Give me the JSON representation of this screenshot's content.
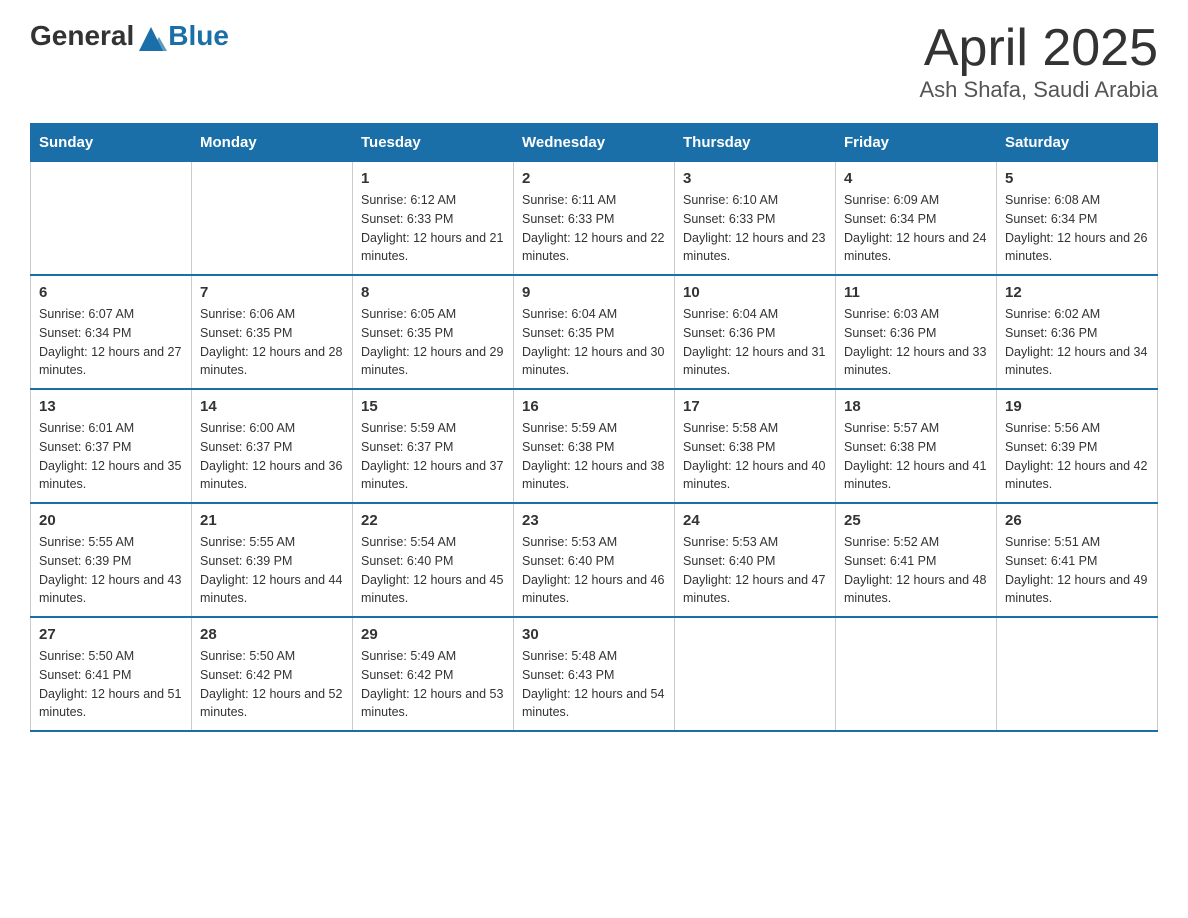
{
  "header": {
    "logo": {
      "general": "General",
      "blue": "Blue"
    },
    "title": "April 2025",
    "subtitle": "Ash Shafa, Saudi Arabia"
  },
  "calendar": {
    "days_of_week": [
      "Sunday",
      "Monday",
      "Tuesday",
      "Wednesday",
      "Thursday",
      "Friday",
      "Saturday"
    ],
    "weeks": [
      [
        {
          "day": "",
          "sunrise": "",
          "sunset": "",
          "daylight": ""
        },
        {
          "day": "",
          "sunrise": "",
          "sunset": "",
          "daylight": ""
        },
        {
          "day": "1",
          "sunrise": "Sunrise: 6:12 AM",
          "sunset": "Sunset: 6:33 PM",
          "daylight": "Daylight: 12 hours and 21 minutes."
        },
        {
          "day": "2",
          "sunrise": "Sunrise: 6:11 AM",
          "sunset": "Sunset: 6:33 PM",
          "daylight": "Daylight: 12 hours and 22 minutes."
        },
        {
          "day": "3",
          "sunrise": "Sunrise: 6:10 AM",
          "sunset": "Sunset: 6:33 PM",
          "daylight": "Daylight: 12 hours and 23 minutes."
        },
        {
          "day": "4",
          "sunrise": "Sunrise: 6:09 AM",
          "sunset": "Sunset: 6:34 PM",
          "daylight": "Daylight: 12 hours and 24 minutes."
        },
        {
          "day": "5",
          "sunrise": "Sunrise: 6:08 AM",
          "sunset": "Sunset: 6:34 PM",
          "daylight": "Daylight: 12 hours and 26 minutes."
        }
      ],
      [
        {
          "day": "6",
          "sunrise": "Sunrise: 6:07 AM",
          "sunset": "Sunset: 6:34 PM",
          "daylight": "Daylight: 12 hours and 27 minutes."
        },
        {
          "day": "7",
          "sunrise": "Sunrise: 6:06 AM",
          "sunset": "Sunset: 6:35 PM",
          "daylight": "Daylight: 12 hours and 28 minutes."
        },
        {
          "day": "8",
          "sunrise": "Sunrise: 6:05 AM",
          "sunset": "Sunset: 6:35 PM",
          "daylight": "Daylight: 12 hours and 29 minutes."
        },
        {
          "day": "9",
          "sunrise": "Sunrise: 6:04 AM",
          "sunset": "Sunset: 6:35 PM",
          "daylight": "Daylight: 12 hours and 30 minutes."
        },
        {
          "day": "10",
          "sunrise": "Sunrise: 6:04 AM",
          "sunset": "Sunset: 6:36 PM",
          "daylight": "Daylight: 12 hours and 31 minutes."
        },
        {
          "day": "11",
          "sunrise": "Sunrise: 6:03 AM",
          "sunset": "Sunset: 6:36 PM",
          "daylight": "Daylight: 12 hours and 33 minutes."
        },
        {
          "day": "12",
          "sunrise": "Sunrise: 6:02 AM",
          "sunset": "Sunset: 6:36 PM",
          "daylight": "Daylight: 12 hours and 34 minutes."
        }
      ],
      [
        {
          "day": "13",
          "sunrise": "Sunrise: 6:01 AM",
          "sunset": "Sunset: 6:37 PM",
          "daylight": "Daylight: 12 hours and 35 minutes."
        },
        {
          "day": "14",
          "sunrise": "Sunrise: 6:00 AM",
          "sunset": "Sunset: 6:37 PM",
          "daylight": "Daylight: 12 hours and 36 minutes."
        },
        {
          "day": "15",
          "sunrise": "Sunrise: 5:59 AM",
          "sunset": "Sunset: 6:37 PM",
          "daylight": "Daylight: 12 hours and 37 minutes."
        },
        {
          "day": "16",
          "sunrise": "Sunrise: 5:59 AM",
          "sunset": "Sunset: 6:38 PM",
          "daylight": "Daylight: 12 hours and 38 minutes."
        },
        {
          "day": "17",
          "sunrise": "Sunrise: 5:58 AM",
          "sunset": "Sunset: 6:38 PM",
          "daylight": "Daylight: 12 hours and 40 minutes."
        },
        {
          "day": "18",
          "sunrise": "Sunrise: 5:57 AM",
          "sunset": "Sunset: 6:38 PM",
          "daylight": "Daylight: 12 hours and 41 minutes."
        },
        {
          "day": "19",
          "sunrise": "Sunrise: 5:56 AM",
          "sunset": "Sunset: 6:39 PM",
          "daylight": "Daylight: 12 hours and 42 minutes."
        }
      ],
      [
        {
          "day": "20",
          "sunrise": "Sunrise: 5:55 AM",
          "sunset": "Sunset: 6:39 PM",
          "daylight": "Daylight: 12 hours and 43 minutes."
        },
        {
          "day": "21",
          "sunrise": "Sunrise: 5:55 AM",
          "sunset": "Sunset: 6:39 PM",
          "daylight": "Daylight: 12 hours and 44 minutes."
        },
        {
          "day": "22",
          "sunrise": "Sunrise: 5:54 AM",
          "sunset": "Sunset: 6:40 PM",
          "daylight": "Daylight: 12 hours and 45 minutes."
        },
        {
          "day": "23",
          "sunrise": "Sunrise: 5:53 AM",
          "sunset": "Sunset: 6:40 PM",
          "daylight": "Daylight: 12 hours and 46 minutes."
        },
        {
          "day": "24",
          "sunrise": "Sunrise: 5:53 AM",
          "sunset": "Sunset: 6:40 PM",
          "daylight": "Daylight: 12 hours and 47 minutes."
        },
        {
          "day": "25",
          "sunrise": "Sunrise: 5:52 AM",
          "sunset": "Sunset: 6:41 PM",
          "daylight": "Daylight: 12 hours and 48 minutes."
        },
        {
          "day": "26",
          "sunrise": "Sunrise: 5:51 AM",
          "sunset": "Sunset: 6:41 PM",
          "daylight": "Daylight: 12 hours and 49 minutes."
        }
      ],
      [
        {
          "day": "27",
          "sunrise": "Sunrise: 5:50 AM",
          "sunset": "Sunset: 6:41 PM",
          "daylight": "Daylight: 12 hours and 51 minutes."
        },
        {
          "day": "28",
          "sunrise": "Sunrise: 5:50 AM",
          "sunset": "Sunset: 6:42 PM",
          "daylight": "Daylight: 12 hours and 52 minutes."
        },
        {
          "day": "29",
          "sunrise": "Sunrise: 5:49 AM",
          "sunset": "Sunset: 6:42 PM",
          "daylight": "Daylight: 12 hours and 53 minutes."
        },
        {
          "day": "30",
          "sunrise": "Sunrise: 5:48 AM",
          "sunset": "Sunset: 6:43 PM",
          "daylight": "Daylight: 12 hours and 54 minutes."
        },
        {
          "day": "",
          "sunrise": "",
          "sunset": "",
          "daylight": ""
        },
        {
          "day": "",
          "sunrise": "",
          "sunset": "",
          "daylight": ""
        },
        {
          "day": "",
          "sunrise": "",
          "sunset": "",
          "daylight": ""
        }
      ]
    ]
  }
}
